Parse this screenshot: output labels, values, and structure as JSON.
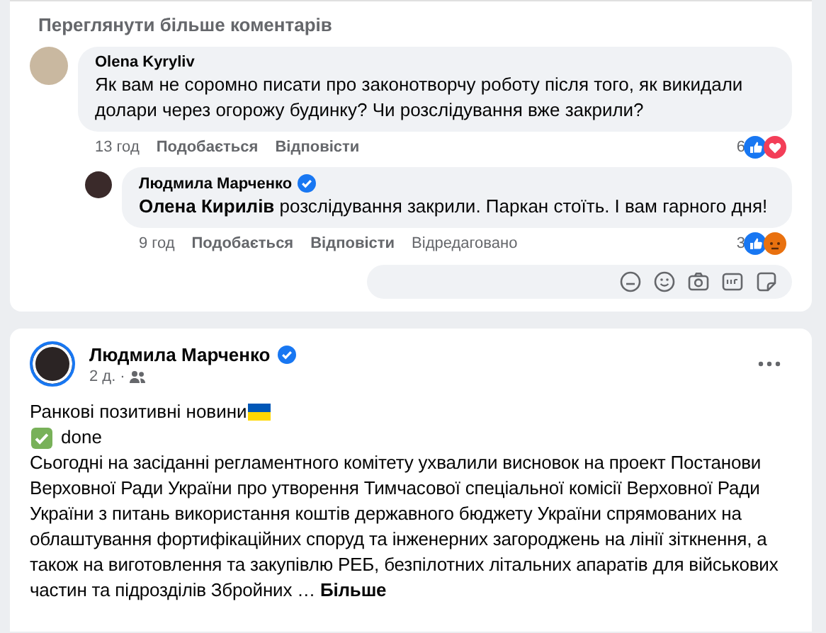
{
  "comments_card": {
    "more_comments": "Переглянути більше коментарів",
    "comments": [
      {
        "author": "Olena Kyryliv",
        "verified": false,
        "text": "Як вам не соромно писати про законотворчу роботу після того, як викидали долари через огорожу будинку? Чи розслідування вже закрили?",
        "time": "13 год",
        "like": "Подобається",
        "reply": "Відповісти",
        "reaction_count": "6",
        "reactions": [
          {
            "kind": "like"
          },
          {
            "kind": "love"
          }
        ],
        "kind": "comment"
      },
      {
        "author": "Людмила Марченко",
        "verified": true,
        "text": "**Олена Кирилів** розслідування закрили. Паркан стоїть. І вам гарного дня!",
        "time": "9 год",
        "like": "Подобається",
        "reply": "Відповісти",
        "edited": "Відредаговано",
        "reaction_count": "3",
        "reactions": [
          {
            "kind": "like"
          },
          {
            "kind": "angry"
          }
        ],
        "kind": "reply"
      }
    ]
  },
  "post": {
    "author": "Людмила Марченко",
    "verified": true,
    "time": "2 д.",
    "separator": "·",
    "title": "Ранкові позитивні новини",
    "done": "done",
    "body": "Сьогодні на засіданні регламентного комітету ухвалили висновок на проект Постанови Верховної Ради України про утворення Тимчасової спеціальної комісії Верховної Ради України з питань використання коштів державного бюджету України спрямованих на облаштування фортифікаційних споруд та інженерних загороджень на лінії зіткнення, а також на виготовлення та закупівлю РЕБ, безпілотних літальних апаратів для військових частин та підрозділів Збройних …",
    "more": "Більше"
  }
}
